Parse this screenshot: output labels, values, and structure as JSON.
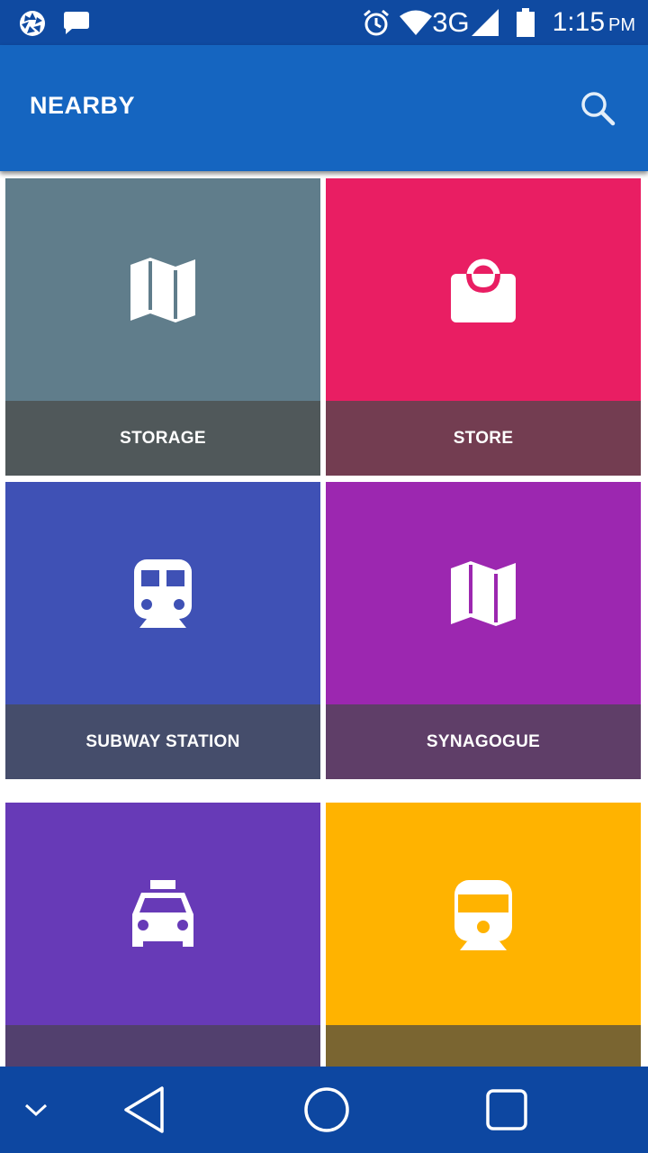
{
  "status_bar": {
    "network": "3G",
    "time": "1:15",
    "ampm": "PM",
    "icons": [
      "aperture-icon",
      "message-icon",
      "alarm-icon",
      "wifi-icon",
      "signal-icon",
      "battery-icon"
    ]
  },
  "app_bar": {
    "title": "NEARBY",
    "search_icon": "search-icon"
  },
  "tiles": [
    {
      "label": "STORAGE",
      "icon": "map-icon",
      "color_top": "#607d8b",
      "color_bottom": "#50585a"
    },
    {
      "label": "STORE",
      "icon": "shopping-bag-icon",
      "color_top": "#e91e63",
      "color_bottom": "#733d51"
    },
    {
      "label": "SUBWAY STATION",
      "icon": "subway-icon",
      "color_top": "#3f51b5",
      "color_bottom": "#454d6b"
    },
    {
      "label": "SYNAGOGUE",
      "icon": "map-icon",
      "color_top": "#9c27b0",
      "color_bottom": "#5f3e68"
    },
    {
      "label": "",
      "icon": "taxi-icon",
      "color_top": "#673ab7",
      "color_bottom": "#52406e"
    },
    {
      "label": "",
      "icon": "train-icon",
      "color_top": "#ffb300",
      "color_bottom": "#7a6531"
    }
  ],
  "nav_bar": {
    "icons": [
      "chevron-down-icon",
      "back-icon",
      "home-icon",
      "recents-icon"
    ]
  }
}
